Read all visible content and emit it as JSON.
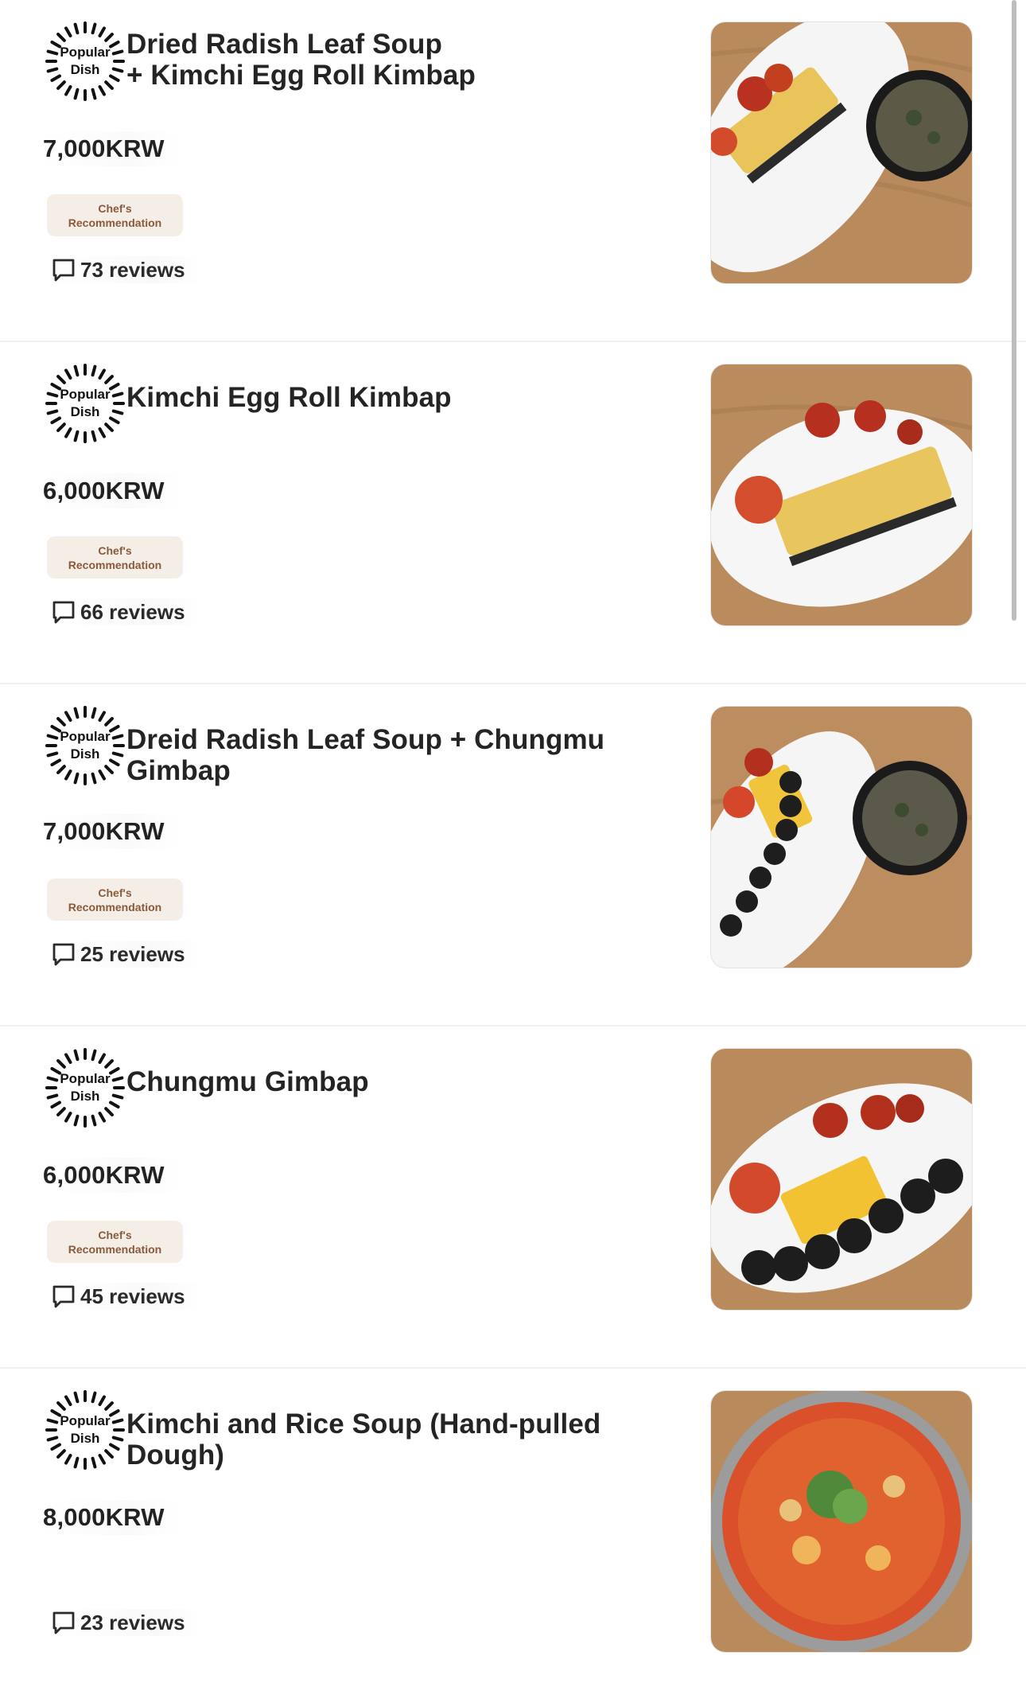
{
  "menu": {
    "items": [
      {
        "badge_line1": "Popular",
        "badge_line2": "Dish",
        "name_line1": "Dried Radish Leaf Soup",
        "name_line2": "+ Kimchi Egg Roll Kimbap",
        "price": "7,000KRW",
        "chef_line1": "Chef's",
        "chef_line2": "Recommendation",
        "reviews": "73 reviews",
        "photo_icon": "egg-roll-kimbap-with-soup-photo"
      },
      {
        "badge_line1": "Popular",
        "badge_line2": "Dish",
        "name_line1": "Kimchi Egg Roll Kimbap",
        "name_line2": "",
        "price": "6,000KRW",
        "chef_line1": "Chef's",
        "chef_line2": "Recommendation",
        "reviews": "66 reviews",
        "photo_icon": "egg-roll-kimbap-photo"
      },
      {
        "badge_line1": "Popular",
        "badge_line2": "Dish",
        "name_line1": "Dreid Radish Leaf Soup + Chungmu Gimbap",
        "name_line2": "",
        "price": "7,000KRW",
        "chef_line1": "Chef's",
        "chef_line2": "Recommendation",
        "reviews": "25 reviews",
        "photo_icon": "chungmu-gimbap-with-soup-photo"
      },
      {
        "badge_line1": "Popular",
        "badge_line2": "Dish",
        "name_line1": "Chungmu Gimbap",
        "name_line2": "",
        "price": "6,000KRW",
        "chef_line1": "Chef's",
        "chef_line2": "Recommendation",
        "reviews": "45 reviews",
        "photo_icon": "chungmu-gimbap-photo"
      },
      {
        "badge_line1": "Popular",
        "badge_line2": "Dish",
        "name_line1": "Kimchi and Rice Soup (Hand-pulled Dough)",
        "name_line2": "",
        "price": "8,000KRW",
        "chef_line1": "",
        "chef_line2": "",
        "reviews": "23 reviews",
        "photo_icon": "kimchi-soup-photo"
      }
    ]
  },
  "colors": {
    "chef_badge_bg": "#f4eee7",
    "chef_badge_text": "#8a5a3b",
    "text": "#242424",
    "scrollbar": "#bdbdbd"
  }
}
